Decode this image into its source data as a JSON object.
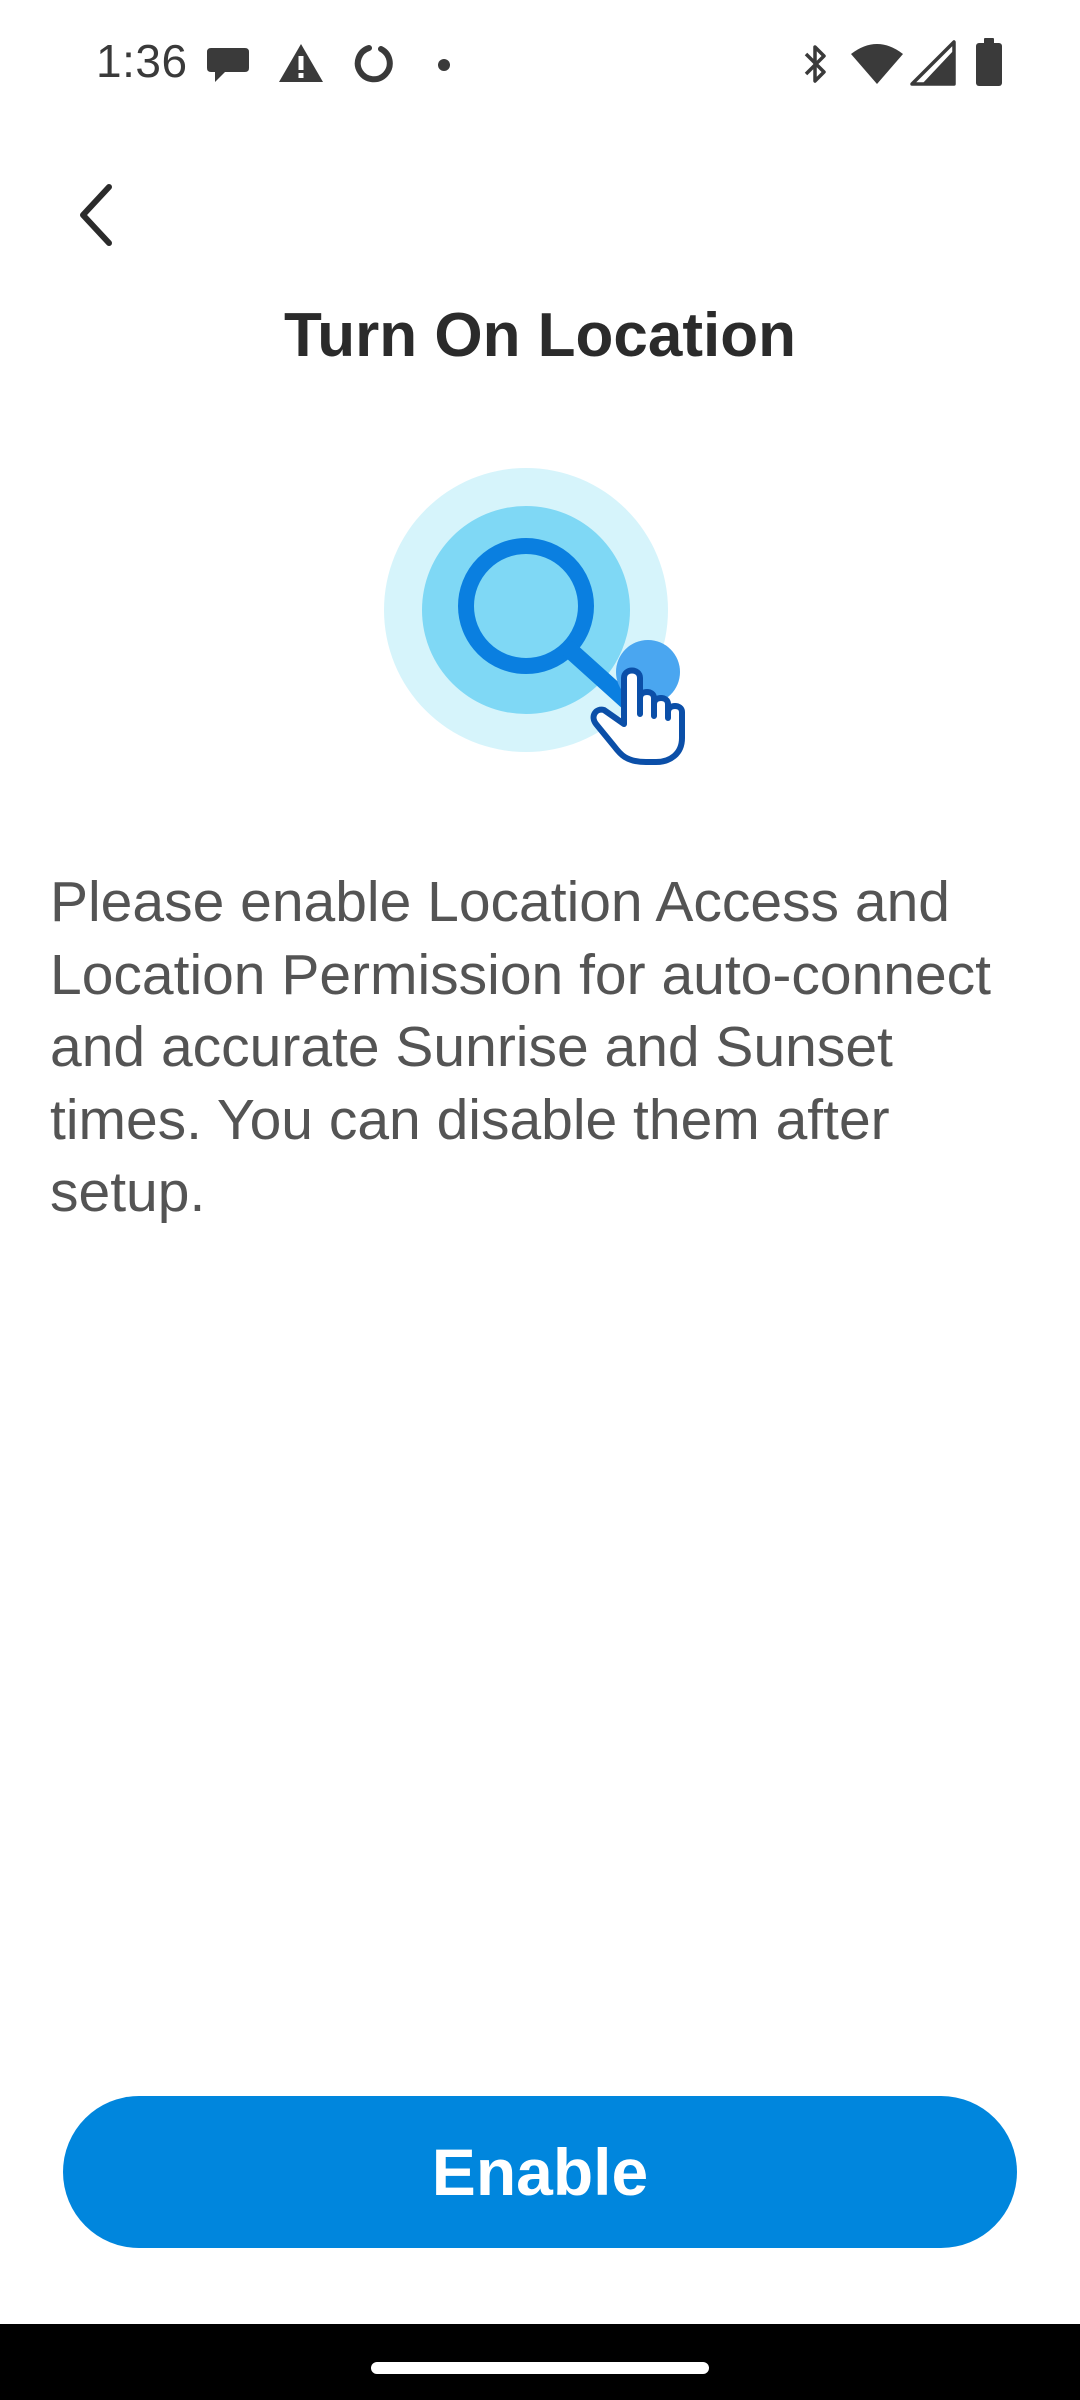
{
  "status_bar": {
    "time": "1:36",
    "left_icons": [
      "chat-icon",
      "warning-icon",
      "circle-icon",
      "dot-icon"
    ],
    "right_icons": [
      "bluetooth-icon",
      "wifi-icon",
      "signal-icon",
      "battery-icon"
    ]
  },
  "header": {
    "back_icon": "chevron-left-icon",
    "title": "Turn On Location"
  },
  "illustration": {
    "icon": "search-location-icon",
    "colors": {
      "outer_ring": "#d6f4fb",
      "inner_ring": "#7fd8f5",
      "lens": "#0a7fe0",
      "hand_outline": "#0b4fa8",
      "touch_dot": "#4aa6f0"
    }
  },
  "main": {
    "description": "Please enable Location Access and Location Permission for auto-connect and accurate Sunrise and Sunset times. You can disable them after setup."
  },
  "actions": {
    "enable_label": "Enable"
  },
  "colors": {
    "accent": "#0086dd",
    "title_text": "#2b2b2b",
    "body_text": "#545454"
  }
}
